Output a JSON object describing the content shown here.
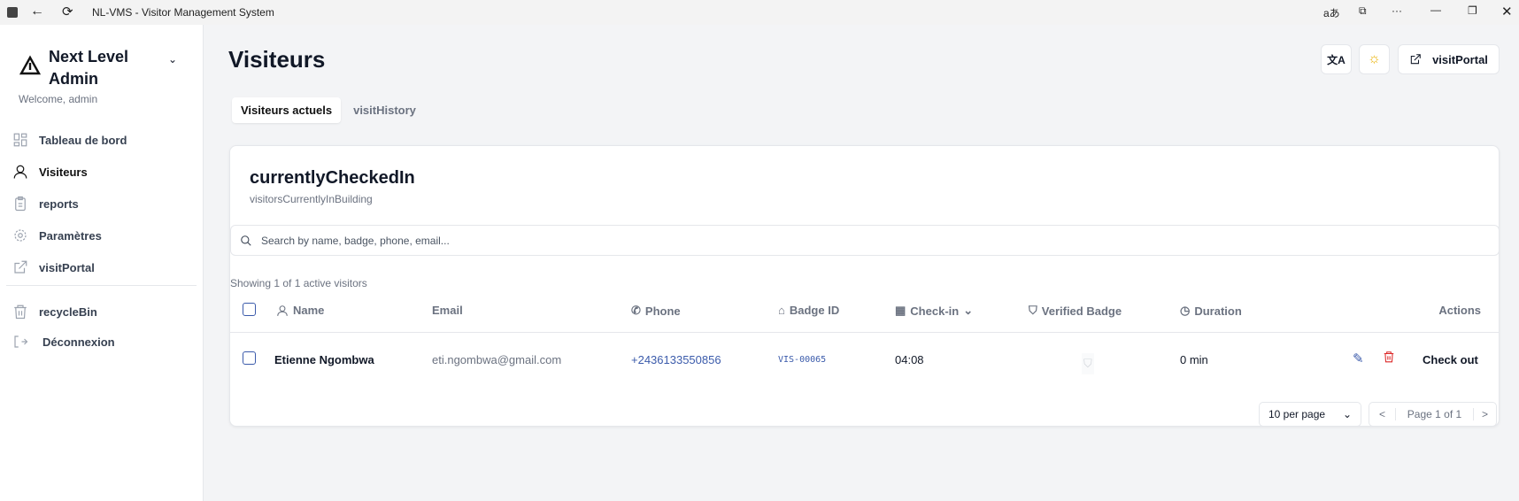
{
  "window": {
    "title": "NL-VMS - Visitor Management System",
    "menu_text": "···"
  },
  "sidebar": {
    "org_line1": "Next Level",
    "org_line2": "Admin",
    "welcome": "Welcome, admin",
    "items": [
      {
        "label": "Tableau de bord"
      },
      {
        "label": "Visiteurs"
      },
      {
        "label": "reports"
      },
      {
        "label": "Paramètres"
      },
      {
        "label": "visitPortal"
      }
    ],
    "recycle": "recycleBin",
    "logout": "Déconnexion"
  },
  "header": {
    "title": "Visiteurs",
    "portal_button": "visitPortal"
  },
  "tabs": [
    {
      "label": "Visiteurs actuels",
      "active": true
    },
    {
      "label": "visitHistory"
    }
  ],
  "card": {
    "title": "currentlyCheckedIn",
    "subtitle": "visitorsCurrentlyInBuilding",
    "search_placeholder": "Search by name, badge, phone, email...",
    "showing": "Showing 1 of 1 active visitors",
    "columns": [
      "Name",
      "Email",
      "Phone",
      "Badge ID",
      "Check-in",
      "Verified Badge",
      "Duration",
      "Actions"
    ],
    "rows": [
      {
        "name": "Etienne Ngombwa",
        "email": "eti.ngombwa@gmail.com",
        "phone": "+2436133550856",
        "badge": "VIS-00065",
        "checkin": "04:08",
        "duration": "0 min",
        "action": "Check out"
      }
    ],
    "per_page": "10 per page",
    "page": "Page 1 of 1",
    "prev": "<",
    "next": ">"
  },
  "colors": {
    "accent": "#3b5bab",
    "delete": "#dc2626",
    "sun": "#eab308"
  }
}
